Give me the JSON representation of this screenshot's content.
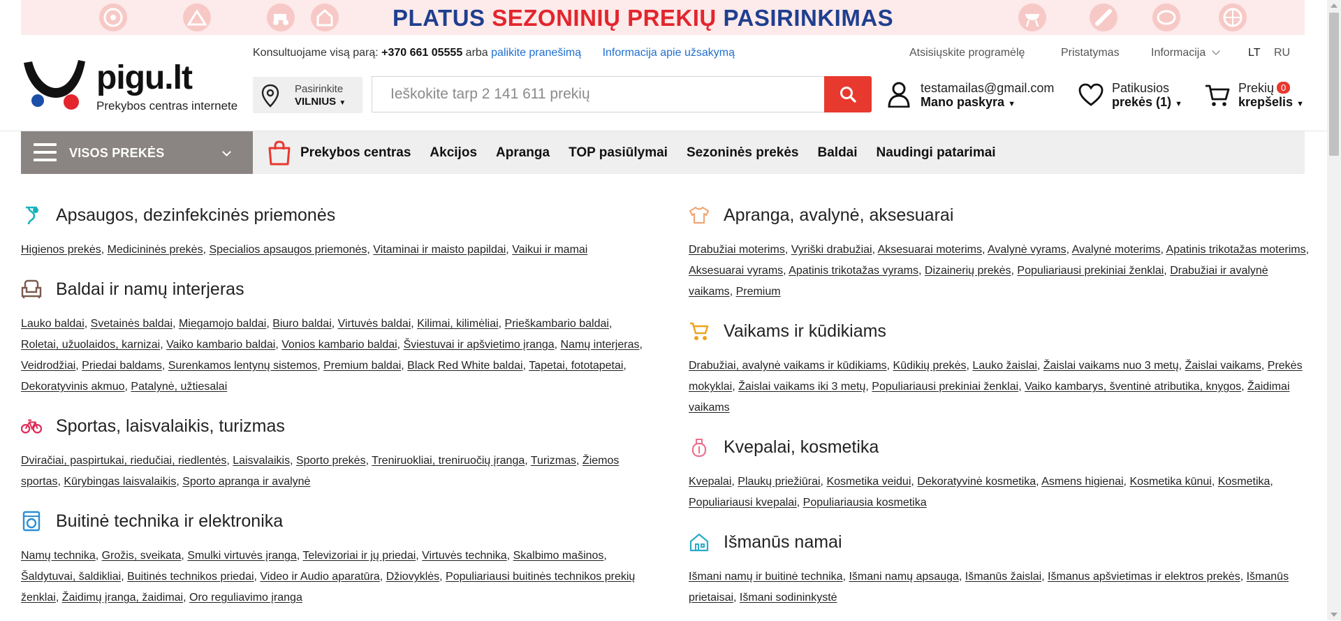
{
  "banner": {
    "text_blue1": "PLATUS ",
    "text_red": "SEZONINIŲ PREKIŲ ",
    "text_blue2": "PASIRINKIMAS",
    "icons": [
      "wheel-icon",
      "tent-icon",
      "lawn-mower-icon",
      "playhouse-icon",
      "grill-icon",
      "chainsaw-icon",
      "pool-icon",
      "ball-icon"
    ]
  },
  "logo": {
    "brand": "pigu.lt",
    "tagline": "Prekybos centras internete"
  },
  "contact": {
    "prefix": "Konsultuojame visą parą: ",
    "phone": "+370 661 05555",
    "or": " arba ",
    "leave_message": "palikite pranešimą",
    "order_info": "Informacija apie užsakymą"
  },
  "toplinks": {
    "app": "Atsisiųskite programėlę",
    "delivery": "Pristatymas",
    "info": "Informacija",
    "lang_lt": "LT",
    "lang_ru": "RU"
  },
  "city": {
    "label": "Pasirinkite",
    "value": "VILNIUS"
  },
  "search": {
    "placeholder": "Ieškokite tarp 2 141 611 prekių"
  },
  "account": {
    "email": "testamailas@gmail.com",
    "label": "Mano paskyra"
  },
  "favorites": {
    "line1": "Patikusios",
    "line2": "prekės (1)"
  },
  "cart": {
    "line1": "Prekių",
    "count": "0",
    "line2": "krepšelis"
  },
  "nav": {
    "all": "VISOS PREKĖS",
    "items": [
      "Prekybos centras",
      "Akcijos",
      "Apranga",
      "TOP pasiūlymai",
      "Sezoninės prekės",
      "Baldai",
      "Naudingi patarimai"
    ]
  },
  "colors": {
    "accent_red": "#e8392e",
    "link_blue": "#1e6fd0",
    "brand_blue": "#1f3f8f"
  },
  "categories_left": [
    {
      "title": "Apsaugos, dezinfekcinės priemonės",
      "icon": "medical-icon",
      "links": [
        "Higienos prekės",
        "Medicininės prekės",
        "Specialios apsaugos priemonės",
        "Vitaminai ir maisto papildai",
        "Vaikui ir mamai"
      ]
    },
    {
      "title": "Baldai ir namų interjeras",
      "icon": "armchair-icon",
      "links": [
        "Lauko baldai",
        "Svetainės baldai",
        "Miegamojo baldai",
        "Biuro baldai",
        "Virtuvės baldai",
        "Kilimai, kilimėliai",
        "Prieškambario baldai",
        "Roletai, užuolaidos, karnizai",
        "Vaiko kambario baldai",
        "Vonios kambario baldai",
        "Šviestuvai ir apšvietimo įranga",
        "Namų interjeras",
        "Veidrodžiai",
        "Priedai baldams",
        "Surenkamos lentynų sistemos",
        "Premium baldai",
        "Black Red White baldai",
        "Tapetai, fototapetai",
        "Dekoratyvinis akmuo",
        "Patalynė, užtiesalai"
      ]
    },
    {
      "title": "Sportas, laisvalaikis, turizmas",
      "icon": "bicycle-icon",
      "links": [
        "Dviračiai, paspirtukai, riedučiai, riedlentės",
        "Laisvalaikis",
        "Sporto prekės",
        "Treniruokliai, treniruočių įranga",
        "Turizmas",
        "Žiemos sportas",
        "Kūrybingas laisvalaikis",
        "Sporto apranga ir avalynė"
      ]
    },
    {
      "title": "Buitinė technika ir elektronika",
      "icon": "washing-machine-icon",
      "links": [
        "Namų technika",
        "Grožis, sveikata",
        "Smulki virtuvės įranga",
        "Televizoriai ir jų priedai",
        "Virtuvės technika",
        "Skalbimo mašinos",
        "Šaldytuvai, šaldikliai",
        "Buitinės technikos priedai",
        "Video ir Audio aparatūra",
        "Džiovyklės",
        "Populiariausi buitinės technikos prekių ženklai",
        "Žaidimų įranga, žaidimai",
        "Oro reguliavimo įranga"
      ]
    }
  ],
  "categories_right": [
    {
      "title": "Apranga, avalynė, aksesuarai",
      "icon": "tshirt-icon",
      "links": [
        "Drabužiai moterims",
        "Vyriški drabužiai",
        "Aksesuarai moterims",
        "Avalynė vyrams",
        "Avalynė moterims",
        "Apatinis trikotažas moterims",
        "Aksesuarai vyrams",
        "Apatinis trikotažas vyrams",
        "Dizainerių prekės",
        "Populiariausi prekiniai ženklai",
        "Drabužiai ir avalynė vaikams",
        "Premium"
      ]
    },
    {
      "title": "Vaikams ir kūdikiams",
      "icon": "stroller-icon",
      "links": [
        "Drabužiai, avalynė vaikams ir kūdikiams",
        "Kūdikių prekės",
        "Lauko žaislai",
        "Žaislai vaikams nuo 3 metų",
        "Žaislai vaikams",
        "Prekės mokyklai",
        "Žaislai vaikams iki 3 metų",
        "Populiariausi prekiniai ženklai",
        "Vaiko kambarys, šventinė atributika, knygos",
        "Žaidimai vaikams"
      ]
    },
    {
      "title": "Kvepalai, kosmetika",
      "icon": "perfume-icon",
      "links": [
        "Kvepalai",
        "Plaukų priežiūrai",
        "Kosmetika veidui",
        "Dekoratyvinė kosmetika",
        "Asmens higienai",
        "Kosmetika kūnui",
        "Kosmetika",
        "Populiariausi kvepalai",
        "Populiariausia kosmetika"
      ]
    },
    {
      "title": "Išmanūs namai",
      "icon": "smart-home-icon",
      "links": [
        "Išmani namų ir buitinė technika",
        "Išmani namų apsauga",
        "Išmanūs žaislai",
        "Išmanus apšvietimas ir elektros prekės",
        "Išmanūs prietaisai",
        "Išmani sodininkystė"
      ]
    }
  ]
}
